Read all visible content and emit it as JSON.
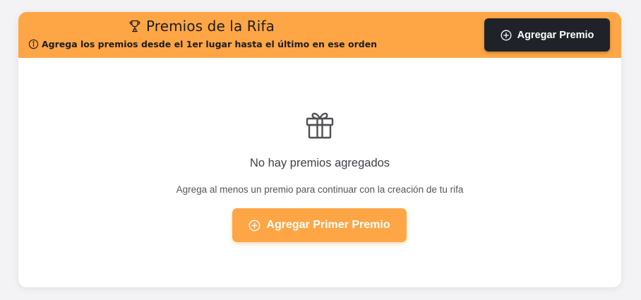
{
  "header": {
    "title": "Premios de la Rifa",
    "title_icon": "trophy-icon",
    "hint": "Agrega los premios desde el 1er lugar hasta el último en ese orden",
    "hint_icon": "info-icon",
    "add_button_label": "Agregar Premio",
    "add_button_icon": "plus-circle-icon"
  },
  "empty_state": {
    "icon": "gift-icon",
    "title": "No hay premios agregados",
    "description": "Agrega al menos un premio para continuar con la creación de tu rifa",
    "button_label": "Agregar Primer Premio",
    "button_icon": "plus-circle-icon"
  },
  "colors": {
    "accent": "#fea646",
    "dark_button": "#1f2329",
    "card_background": "#ffffff",
    "page_background": "#f3f3f5"
  }
}
